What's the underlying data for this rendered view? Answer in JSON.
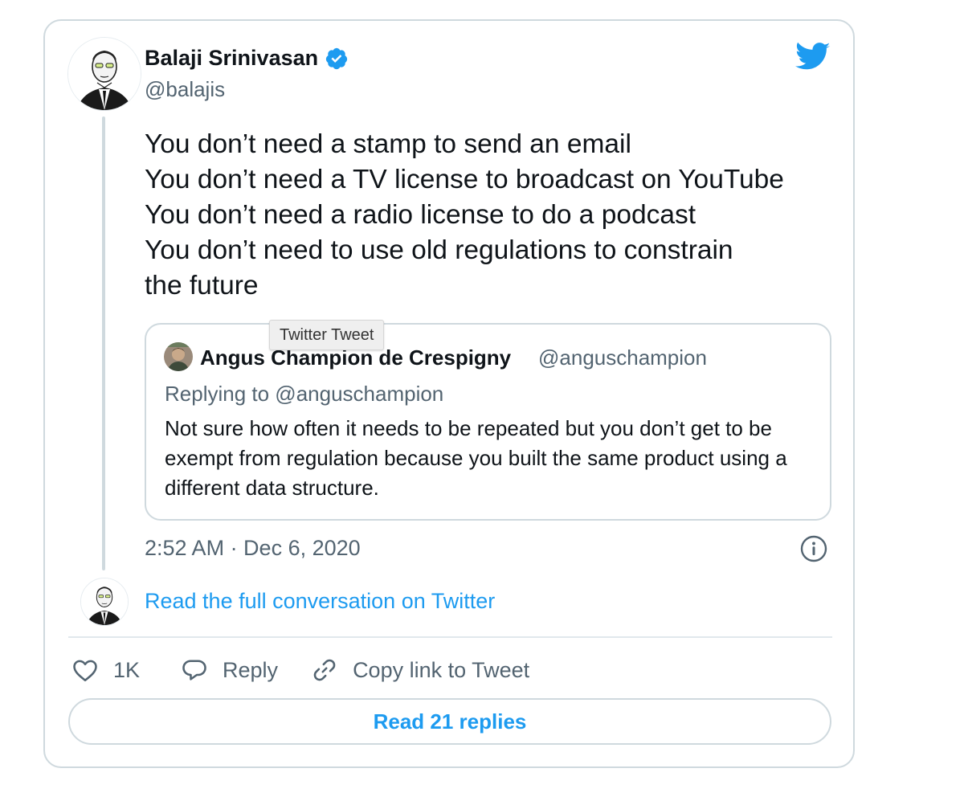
{
  "colors": {
    "accent": "#1d9bf0",
    "text_primary": "#0f1419",
    "text_secondary": "#536471",
    "border": "#cfd9de"
  },
  "tweet": {
    "author": {
      "name": "Balaji Srinivasan",
      "handle": "@balajis",
      "verified": true,
      "avatar_icon": "avatar-illustration-icon"
    },
    "logo_icon": "twitter-bird-icon",
    "text_lines": [
      "You don’t need a stamp to send an email",
      "You don’t need a TV license to broadcast on YouTube",
      "You don’t need a radio license to do a podcast",
      "You don’t need to use old regulations to constrain",
      "the future"
    ],
    "timestamp": "2:52 AM · Dec 6, 2020",
    "info_icon": "info-icon"
  },
  "tooltip": {
    "text": "Twitter Tweet"
  },
  "quoted_tweet": {
    "author_name": "Angus Champion de Crespigny",
    "author_handle": "@anguschampion",
    "replying_to": "Replying to @anguschampion",
    "text": "Not sure how often it needs to be repeated but you don’t get to be exempt from regulation because you built the same product using a different data structure."
  },
  "conversation_link": "Read the full conversation on Twitter",
  "actions": {
    "like_count": "1K",
    "like_icon": "heart-icon",
    "reply_label": "Reply",
    "reply_icon": "speech-bubble-icon",
    "copy_link_label": "Copy link to Tweet",
    "copy_link_icon": "link-icon"
  },
  "read_replies_label": "Read 21 replies"
}
